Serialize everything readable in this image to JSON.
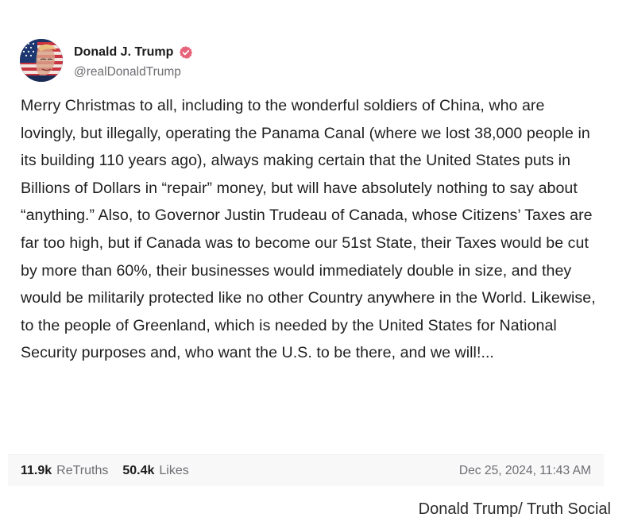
{
  "post": {
    "author": {
      "display_name": "Donald J. Trump",
      "handle": "@realDonaldTrump",
      "verified": true,
      "avatar_icon": "avatar-american-flag-portrait",
      "verified_icon": "verified-badge-icon",
      "verified_color": "#e7637a"
    },
    "body": "Merry Christmas to all, including to the wonderful soldiers of China, who are lovingly, but illegally, operating the Panama Canal (where we lost 38,000 people in its building 110 years ago), always making certain that the United States puts in Billions of Dollars in “repair” money, but will have absolutely nothing to say about “anything.” Also, to Governor Justin Trudeau of Canada, whose Citizens’ Taxes are far too high, but if Canada was to become our 51st State, their Taxes would be cut by more than 60%, their businesses would immediately double in size, and they would be militarily protected like no other Country anywhere in the World. Likewise, to the people of Greenland, which is needed by the United States for National Security purposes and, who want the U.S. to be there, and we will!...",
    "stats": {
      "retruths_count": "11.9k",
      "retruths_label": "ReTruths",
      "likes_count": "50.4k",
      "likes_label": "Likes",
      "timestamp": "Dec 25, 2024, 11:43 AM"
    }
  },
  "caption": "Donald Trump/ Truth Social",
  "colors": {
    "text_primary": "#1f1f1f",
    "text_muted": "#6e6e73",
    "stats_bg": "#f8f8f9",
    "verified_badge": "#e7637a"
  }
}
